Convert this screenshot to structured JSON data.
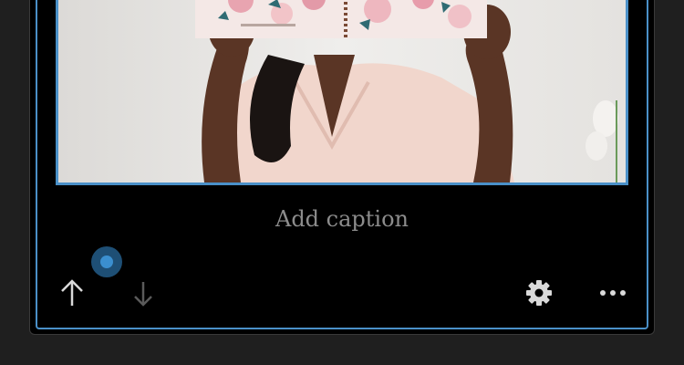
{
  "block": {
    "caption_placeholder": "Add caption"
  },
  "toolbar": {
    "move_up_icon": "arrow-up-icon",
    "move_down_icon": "arrow-down-icon",
    "settings_icon": "gear-icon",
    "more_icon": "more-horizontal-icon"
  },
  "colors": {
    "background": "#1f1f1f",
    "block_background": "#000000",
    "selection_border": "#4a90c8",
    "caption_text": "#8c8c8c",
    "icon_active": "#d9d9d9",
    "icon_disabled": "#5a5a5a",
    "focus_indicator": "#3b8fcf"
  }
}
